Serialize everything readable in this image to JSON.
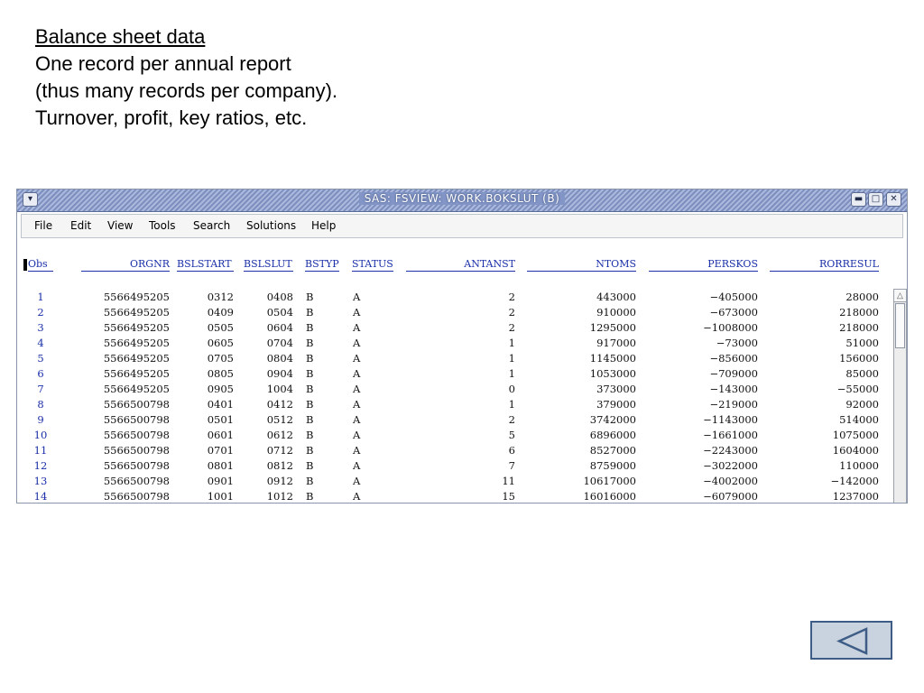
{
  "slide": {
    "heading": "Balance sheet data",
    "lines": [
      "One record per annual report",
      "(thus many records per company).",
      "Turnover, profit, key ratios, etc."
    ]
  },
  "window": {
    "title": "SAS: FSVIEW:  WORK.BOKSLUT (B)",
    "menu": [
      "File",
      "Edit",
      "View",
      "Tools",
      "Search",
      "Solutions",
      "Help"
    ]
  },
  "table": {
    "columns": [
      "Obs",
      "ORGNR",
      "BSLSTART",
      "BSLSLUT",
      "BSTYP",
      "STATUS",
      "ANTANST",
      "NTOMS",
      "PERSKOS",
      "RORRESUL"
    ],
    "rows": [
      [
        "1",
        "5566495205",
        "0312",
        "0408",
        "B",
        "A",
        "2",
        "443000",
        "−405000",
        "28000"
      ],
      [
        "2",
        "5566495205",
        "0409",
        "0504",
        "B",
        "A",
        "2",
        "910000",
        "−673000",
        "218000"
      ],
      [
        "3",
        "5566495205",
        "0505",
        "0604",
        "B",
        "A",
        "2",
        "1295000",
        "−1008000",
        "218000"
      ],
      [
        "4",
        "5566495205",
        "0605",
        "0704",
        "B",
        "A",
        "1",
        "917000",
        "−73000",
        "51000"
      ],
      [
        "5",
        "5566495205",
        "0705",
        "0804",
        "B",
        "A",
        "1",
        "1145000",
        "−856000",
        "156000"
      ],
      [
        "6",
        "5566495205",
        "0805",
        "0904",
        "B",
        "A",
        "1",
        "1053000",
        "−709000",
        "85000"
      ],
      [
        "7",
        "5566495205",
        "0905",
        "1004",
        "B",
        "A",
        "0",
        "373000",
        "−143000",
        "−55000"
      ],
      [
        "8",
        "5566500798",
        "0401",
        "0412",
        "B",
        "A",
        "1",
        "379000",
        "−219000",
        "92000"
      ],
      [
        "9",
        "5566500798",
        "0501",
        "0512",
        "B",
        "A",
        "2",
        "3742000",
        "−1143000",
        "514000"
      ],
      [
        "10",
        "5566500798",
        "0601",
        "0612",
        "B",
        "A",
        "5",
        "6896000",
        "−1661000",
        "1075000"
      ],
      [
        "11",
        "5566500798",
        "0701",
        "0712",
        "B",
        "A",
        "6",
        "8527000",
        "−2243000",
        "1604000"
      ],
      [
        "12",
        "5566500798",
        "0801",
        "0812",
        "B",
        "A",
        "7",
        "8759000",
        "−3022000",
        "110000"
      ],
      [
        "13",
        "5566500798",
        "0901",
        "0912",
        "B",
        "A",
        "11",
        "10617000",
        "−4002000",
        "−142000"
      ],
      [
        "14",
        "5566500798",
        "1001",
        "1012",
        "B",
        "A",
        "15",
        "16016000",
        "−6079000",
        "1237000"
      ]
    ]
  },
  "icons": {
    "window_menu": "chevron-down-icon",
    "minimize": "minimize-icon",
    "maximize": "maximize-icon",
    "close": "close-icon",
    "back": "back-triangle-icon"
  },
  "colors": {
    "header_blue": "#1a2fa8",
    "titlebar": "#8295c6",
    "back_button": "#c9d2df"
  }
}
